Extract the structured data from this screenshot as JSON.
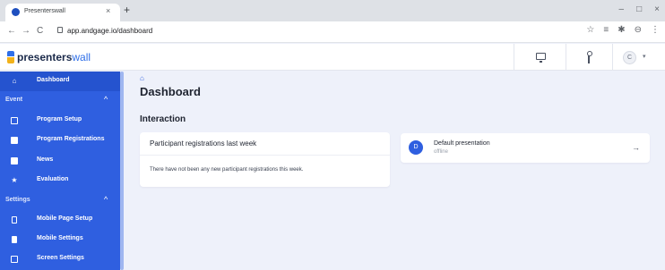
{
  "browser": {
    "tab_title": "Presenterswall",
    "tab_close": "×",
    "new_tab": "+",
    "window_buttons": [
      "–",
      "□",
      "×"
    ],
    "nav_back": "←",
    "nav_forward": "→",
    "nav_reload": "C",
    "url": "app.andgage.io/dashboard",
    "extension_icons": [
      "☆",
      "≡",
      "✱",
      "⊖",
      "⋮"
    ]
  },
  "header": {
    "logo_primary": "presenters",
    "logo_secondary": "wall",
    "avatar_initial": "C",
    "avatar_caret": "▾"
  },
  "sidebar": {
    "dashboard_label": "Dashboard",
    "event_section": "Event",
    "event_chevron": "^",
    "event_items": [
      {
        "label": "Program Setup",
        "icon": "square-icon"
      },
      {
        "label": "Program Registrations",
        "icon": "user-card-icon"
      },
      {
        "label": "News",
        "icon": "news-icon"
      },
      {
        "label": "Evaluation",
        "icon": "star-icon"
      }
    ],
    "settings_section": "Settings",
    "settings_chevron": "^",
    "settings_items": [
      {
        "label": "Mobile Page Setup",
        "icon": "mobile-icon"
      },
      {
        "label": "Mobile Settings",
        "icon": "mobile-settings-icon"
      },
      {
        "label": "Screen Settings",
        "icon": "screen-icon"
      }
    ]
  },
  "main": {
    "home_icon": "⌂",
    "page_title": "Dashboard",
    "section_title": "Interaction",
    "registrations_card": {
      "title": "Participant registrations last week",
      "empty_text": "There have not been any new participant registrations this week."
    },
    "presentation_card": {
      "initial": "D",
      "name": "Default presentation",
      "status": "offline",
      "arrow": "→"
    }
  },
  "colors": {
    "sidebar": "#2f5fe0",
    "accent": "#2f6fe8",
    "logo_yellow": "#f2b21a",
    "background": "#eef1fa"
  }
}
